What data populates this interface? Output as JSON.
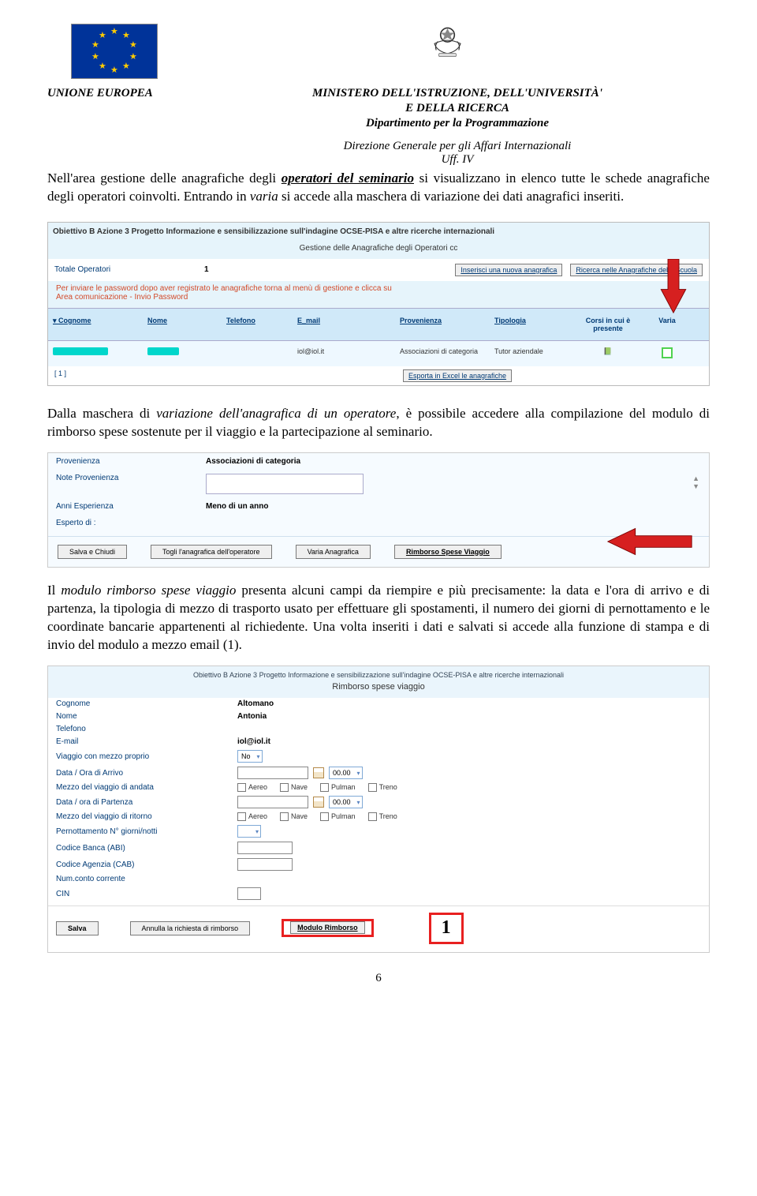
{
  "header": {
    "left_title": "UNIONE EUROPEA",
    "right_title": "MINISTERO DELL'ISTRUZIONE, DELL'UNIVERSITÀ'",
    "right_sub1": "E DELLA RICERCA",
    "right_sub2": "Dipartimento per la Programmazione",
    "dir1": "Direzione Generale per gli Affari Internazionali",
    "dir2": "Uff. IV"
  },
  "para1_a": "Nell'area gestione delle anagrafiche degli ",
  "para1_b": "operatori del seminario",
  "para1_c": " si visualizzano in elenco tutte le schede anagrafiche degli operatori coinvolti. Entrando in ",
  "para1_d": "varia",
  "para1_e": " si accede alla maschera di variazione dei dati anagrafici inseriti.",
  "ss1": {
    "title1": "Obiettivo B Azione 3 Progetto Informazione e sensibilizzazione sull'indagine OCSE-PISA e altre ricerche internazionali",
    "title2": "Gestione delle Anagrafiche degli Operatori cc",
    "totop_label": "Totale Operatori",
    "totop_value": "1",
    "btn_new": "Inserisci una nuova anagrafica",
    "btn_search": "Ricerca nelle Anagrafiche della Scuola",
    "note1": "Per inviare le password dopo aver registrato le anagrafiche torna al menù di gestione e clicca su",
    "note2": "Area comunicazione - Invio Password",
    "cols": {
      "cognome": "Cognome",
      "nome": "Nome",
      "telefono": "Telefono",
      "email": "E_mail",
      "provenienza": "Provenienza",
      "tipologia": "Tipologia",
      "corsi": "Corsi in cui è presente",
      "varia": "Varia"
    },
    "row": {
      "email": "iol@iol.it",
      "prov": "Associazioni di categoria",
      "tip": "Tutor aziendale"
    },
    "footer_pg": "[ 1 ]",
    "footer_btn": "Esporta in Excel le anagrafiche"
  },
  "para2_a": "Dalla maschera di ",
  "para2_b": "variazione dell'anagrafica di un operatore",
  "para2_c": ", è possibile accedere alla compilazione del modulo di rimborso spese sostenute per il viaggio e la partecipazione al seminario.",
  "ss2": {
    "prov_lbl": "Provenienza",
    "prov_val": "Associazioni di categoria",
    "note_lbl": "Note Provenienza",
    "anni_lbl": "Anni Esperienza",
    "anni_val": "Meno di un anno",
    "esp_lbl": "Esperto di :",
    "btn_salva": "Salva e Chiudi",
    "btn_togli": "Togli l'anagrafica dell'operatore",
    "btn_varia": "Varia Anagrafica",
    "btn_rimb": "Rimborso Spese Viaggio"
  },
  "para3_a": "Il ",
  "para3_b": "modulo rimborso spese viaggio",
  "para3_c": " presenta alcuni campi da riempire e più precisamente: la data e l'ora di arrivo e di partenza, la tipologia di mezzo di trasporto usato per effettuare gli spostamenti, il numero dei giorni di pernottamento e le coordinate bancarie appartenenti al richiedente. Una volta inseriti i dati e salvati si accede alla funzione di stampa e di invio del modulo a mezzo email (1).",
  "ss3": {
    "head1": "Obiettivo B Azione 3 Progetto Informazione e sensibilizzazione sull'indagine OCSE-PISA e altre ricerche internazionali",
    "head2": "Rimborso spese viaggio",
    "cognome_lbl": "Cognome",
    "cognome_val": "Altomano",
    "nome_lbl": "Nome",
    "nome_val": "Antonia",
    "tel_lbl": "Telefono",
    "email_lbl": "E-mail",
    "email_val": "iol@iol.it",
    "mezzo_prop_lbl": "Viaggio con mezzo proprio",
    "mezzo_prop_val": "No",
    "arrivo_lbl": "Data / Ora di Arrivo",
    "ora_default": "00.00",
    "andata_lbl": "Mezzo del viaggio di andata",
    "partenza_lbl": "Data / ora di Partenza",
    "ritorno_lbl": "Mezzo del viaggio di ritorno",
    "pernott_lbl": "Pernottamento N° giorni/notti",
    "abi_lbl": "Codice Banca (ABI)",
    "cab_lbl": "Codice Agenzia (CAB)",
    "conto_lbl": "Num.conto corrente",
    "cin_lbl": "CIN",
    "opts": {
      "aereo": "Aereo",
      "nave": "Nave",
      "pulman": "Pulman",
      "treno": "Treno"
    },
    "btn_salva": "Salva",
    "btn_annulla": "Annulla la richiesta di rimborso",
    "btn_modulo": "Modulo Rimborso",
    "callout": "1"
  },
  "page_number": "6"
}
